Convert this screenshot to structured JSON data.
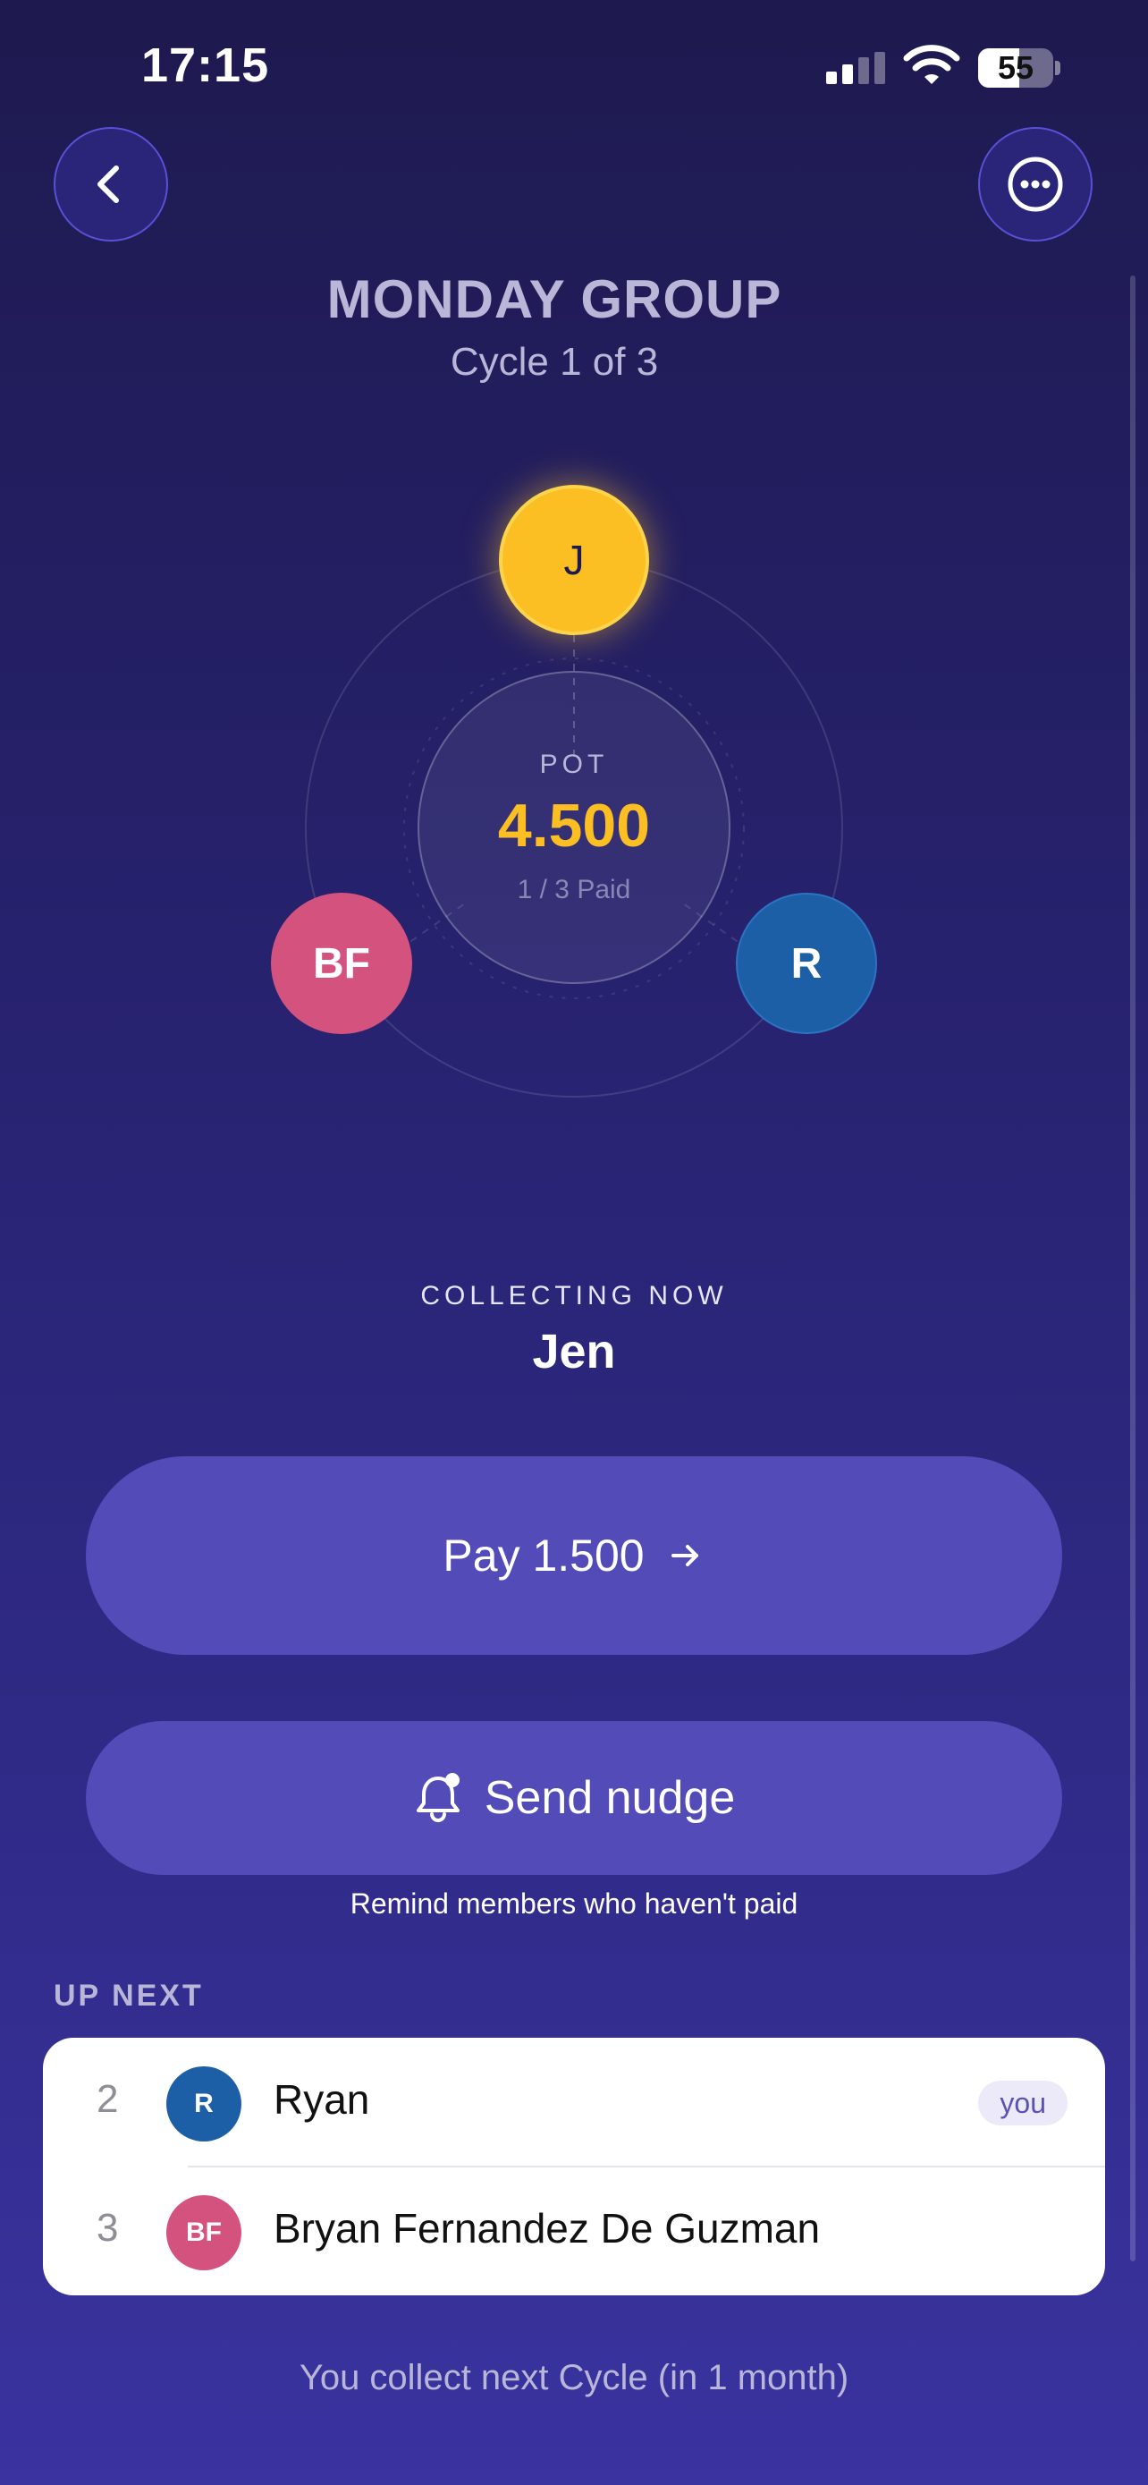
{
  "status_bar": {
    "time": "17:15",
    "battery": "55",
    "battery_level": 0.55
  },
  "nav": {
    "back_icon": "chevron-left-icon",
    "more_icon": "more-horizontal-icon"
  },
  "header": {
    "title": "MONDAY GROUP",
    "cycle": "Cycle 1 of 3"
  },
  "pot": {
    "label": "POT",
    "amount": "4.500",
    "paid": "1 / 3 Paid",
    "members": [
      {
        "initials": "J",
        "color": "#fbbf24",
        "status": "collecting"
      },
      {
        "initials": "BF",
        "color": "#d4537e"
      },
      {
        "initials": "R",
        "color": "#1d5fa6"
      }
    ]
  },
  "collecting": {
    "label": "COLLECTING NOW",
    "name": "Jen"
  },
  "actions": {
    "pay_label": "Pay 1.500",
    "pay_icon": "arrow-right-icon",
    "nudge_label": "Send nudge",
    "nudge_icon": "bell-icon",
    "remind_text": "Remind members who haven't paid"
  },
  "up_next": {
    "label": "UP NEXT",
    "rows": [
      {
        "number": "2",
        "initials": "R",
        "name": "Ryan",
        "badge": "you",
        "color": "#1d5fa6"
      },
      {
        "number": "3",
        "initials": "BF",
        "name": "Bryan Fernandez De Guzman",
        "color": "#d4537e"
      }
    ]
  },
  "footer": {
    "text": "You collect next Cycle (in 1 month)"
  },
  "colors": {
    "accent": "#fbbf24",
    "button": "#524bb8",
    "background_top": "#1e1a4f",
    "background_bottom": "#3a33a0"
  }
}
